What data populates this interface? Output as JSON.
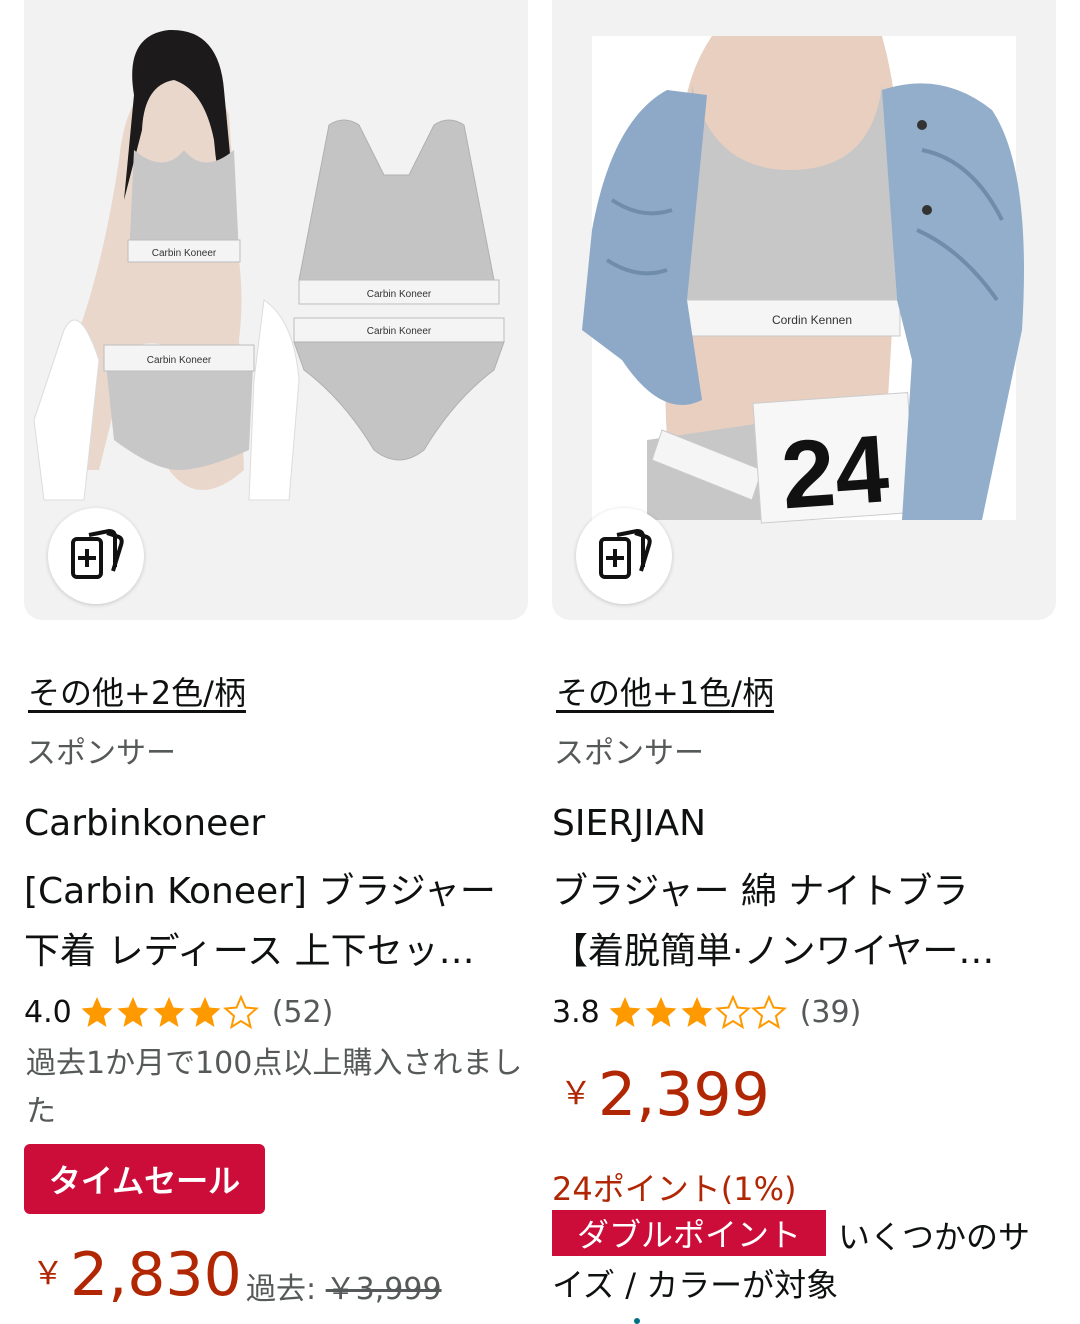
{
  "products": [
    {
      "colors_link": "その他+2色/柄",
      "sponsor_label": "スポンサー",
      "brand": "Carbinkoneer",
      "title_line1": "[Carbin Koneer] ブラジャー",
      "title_line2": "下着 レディース 上下セッ…",
      "rating": "4.0",
      "rating_value": 4.0,
      "review_count": "(52)",
      "bought_text": "過去1か月で100点以上購入されました",
      "deal_badge": "タイムセール",
      "currency": "￥",
      "price": "2,830",
      "was_label": "過去:",
      "was_price": "￥3,999",
      "band_text": "Carbin Koneer"
    },
    {
      "colors_link": "その他+1色/柄",
      "sponsor_label": "スポンサー",
      "brand": "SIERJIAN",
      "title_line1": "ブラジャー 綿 ナイトブラ",
      "title_line2": "【着脱簡単·ノンワイヤー…",
      "rating": "3.8",
      "rating_value": 3.8,
      "review_count": "(39)",
      "currency": "￥",
      "price": "2,399",
      "points": "24ポイント(1%)",
      "double_badge": "ダブルポイント",
      "double_note_1": "いくつかのサ",
      "double_note_2": "イズ / カラーが対象",
      "band_text": "Cordin Kennen",
      "bib_number": "24"
    }
  ],
  "icons": {
    "add_to_compare": "add-to-list-icon",
    "star_full": "star-full-icon",
    "star_half": "star-half-icon",
    "star_empty": "star-empty-icon"
  },
  "colors": {
    "star": "#ff9900",
    "price": "#b12704",
    "badge_red": "#cc0c39",
    "secondary_text": "#565959",
    "image_bg": "#f2f2f2"
  }
}
